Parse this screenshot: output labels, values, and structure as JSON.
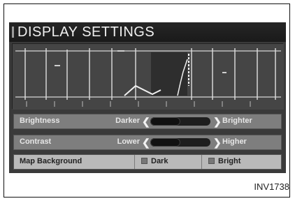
{
  "screen": {
    "title": "DISPLAY SETTINGS"
  },
  "settings": {
    "brightness": {
      "label": "Brightness",
      "low_label": "Darker",
      "high_label": "Brighter",
      "level": 0.5
    },
    "contrast": {
      "label": "Contrast",
      "low_label": "Lower",
      "high_label": "Higher",
      "level": 0.5
    },
    "map_background": {
      "label": "Map Background",
      "options": [
        "Dark",
        "Bright"
      ]
    }
  },
  "figure": {
    "caption": "INV1738"
  },
  "colors": {
    "screen_background": "#3a3a3a",
    "title_bar": "#1a1a1a",
    "slider_row": "#7e7e7e",
    "option_row": "#b9b9b9"
  },
  "icons": {
    "left": "chevron-left-icon",
    "right": "chevron-right-icon"
  }
}
